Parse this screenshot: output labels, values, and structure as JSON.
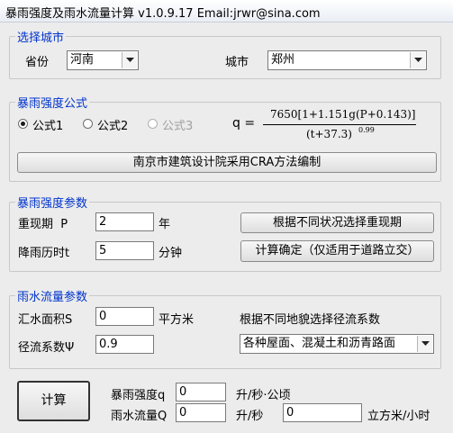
{
  "window": {
    "title": "暴雨强度及雨水流量计算 v1.0.9.17 Email:jrwr@sina.com"
  },
  "city_group": {
    "label": "选择城市",
    "province_label": "省份",
    "province_value": "河南",
    "city_label": "城市",
    "city_value": "郑州"
  },
  "formula_group": {
    "label": "暴雨强度公式",
    "options": [
      {
        "label": "公式1",
        "checked": true,
        "disabled": false
      },
      {
        "label": "公式2",
        "checked": false,
        "disabled": false
      },
      {
        "label": "公式3",
        "checked": false,
        "disabled": true
      }
    ],
    "q_label": "q =",
    "numerator": "7650[1+1.151g(P+0.143)]",
    "denominator": "(t+37.3)",
    "exponent": "0.99",
    "method_button": "南京市建筑设计院采用CRA方法编制"
  },
  "params_group": {
    "label": "暴雨强度参数",
    "period_label": "重现期  P",
    "period_value": "2",
    "period_unit": "年",
    "duration_label": "降雨历时t",
    "duration_value": "5",
    "duration_unit": "分钟",
    "choose_period_button": "根据不同状况选择重现期",
    "confirm_button": "计算确定（仅适用于道路立交）"
  },
  "flow_group": {
    "label": "雨水流量参数",
    "area_label": "汇水面积S",
    "area_value": "0",
    "area_unit": "平方米",
    "coef_hint": "根据不同地貌选择径流系数",
    "coef_label": "径流系数Ψ",
    "coef_value": "0.9",
    "surface_value": "各种屋面、混凝土和沥青路面"
  },
  "results": {
    "calc_button": "计算",
    "intensity_label": "暴雨强度q",
    "intensity_value": "0",
    "intensity_unit": "升/秒·公顷",
    "flow_label": "雨水流量Q",
    "flow_value_l": "0",
    "flow_unit_l": "升/秒",
    "flow_value_m3": "0",
    "flow_unit_m3": "立方米/小时"
  },
  "icons": {
    "dropdown": "chevron-down-icon"
  }
}
